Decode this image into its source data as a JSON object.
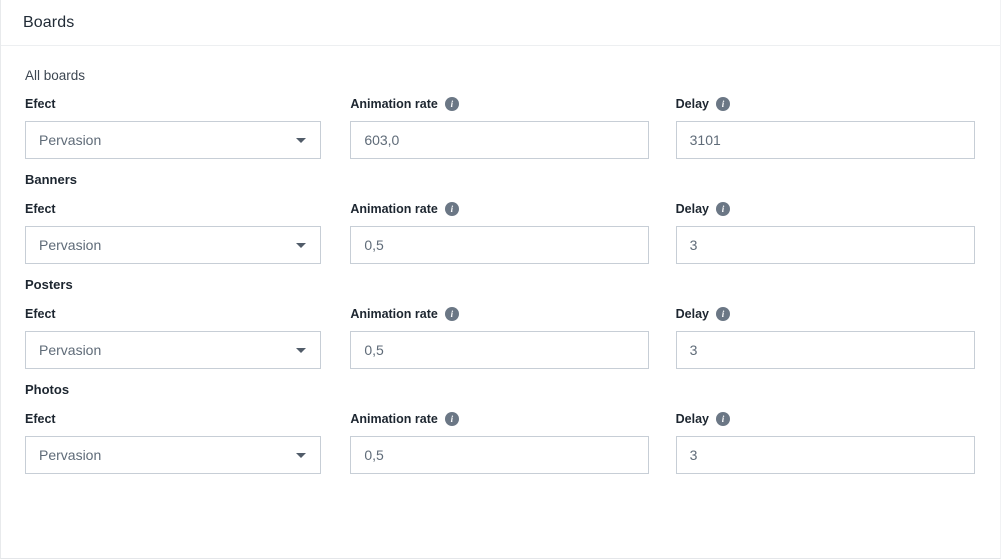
{
  "header": {
    "title": "Boards"
  },
  "labels": {
    "effect": "Efect",
    "animation_rate": "Animation rate",
    "delay": "Delay",
    "info_icon_glyph": "i",
    "info_icon_name": "info-icon",
    "caret_icon_name": "chevron-down-icon"
  },
  "colors": {
    "text_primary": "#1d2630",
    "text_secondary": "#5f6b78",
    "border": "#c7ced6",
    "divider": "#edeff1",
    "info_icon_bg": "#6b7785"
  },
  "sections": [
    {
      "heading": "All boards",
      "heading_bold": false,
      "effect": "Pervasion",
      "animation_rate": "603,0",
      "delay": "3101"
    },
    {
      "heading": "Banners",
      "heading_bold": true,
      "effect": "Pervasion",
      "animation_rate": "0,5",
      "delay": "3"
    },
    {
      "heading": "Posters",
      "heading_bold": true,
      "effect": "Pervasion",
      "animation_rate": "0,5",
      "delay": "3"
    },
    {
      "heading": "Photos",
      "heading_bold": true,
      "effect": "Pervasion",
      "animation_rate": "0,5",
      "delay": "3"
    }
  ]
}
